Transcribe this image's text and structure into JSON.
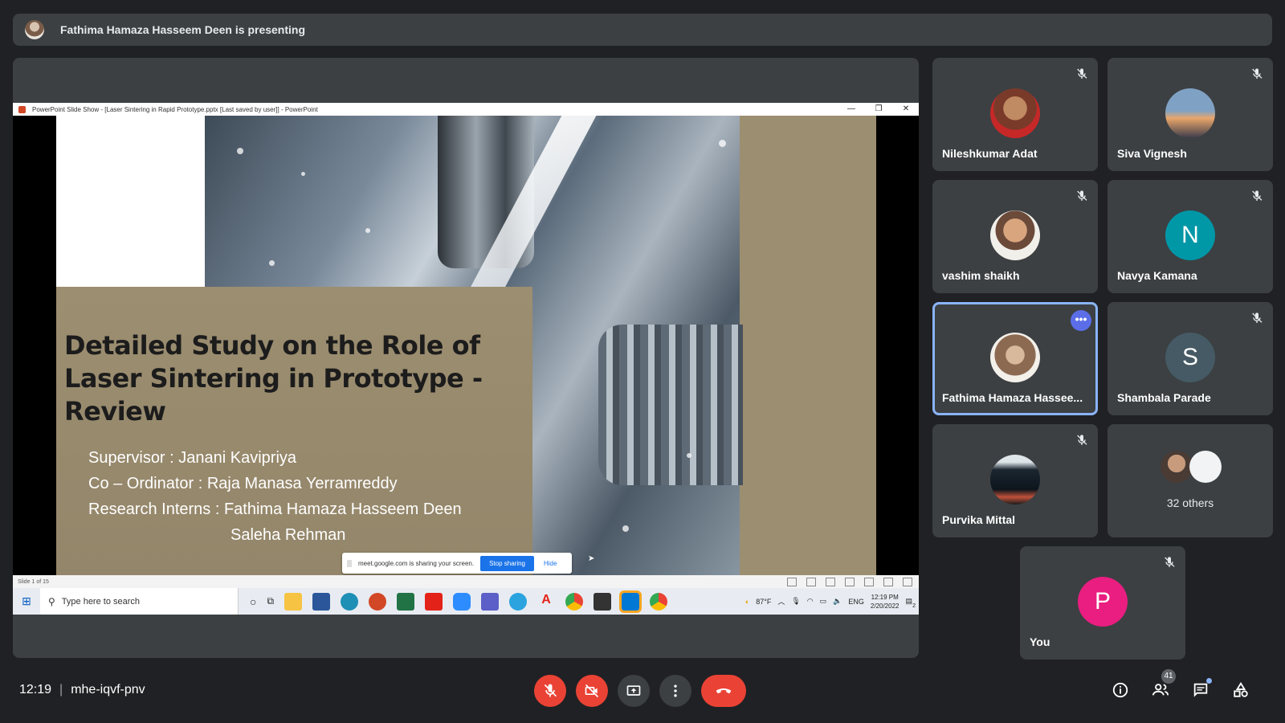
{
  "presenting_banner": {
    "text": "Fathima Hamaza Hasseem Deen is presenting"
  },
  "shared_screen": {
    "window_title": "PowerPoint Slide Show - [Laser Sintering in Rapid Prototype.pptx [Last saved by user]] - PowerPoint",
    "slide": {
      "title": "Detailed Study on the Role of Laser Sintering in Prototype - Review",
      "supervisor": "Supervisor :  Janani Kavipriya",
      "coordinator": "Co – Ordinator : Raja Manasa Yerramreddy",
      "interns_line1": "Research  Interns : Fathima Hamaza Hasseem Deen",
      "interns_line2": "Saleha Rehman"
    },
    "status_slide_count": "Slide 1 of 15",
    "share_notice": {
      "text": "meet.google.com is sharing your screen.",
      "stop_label": "Stop sharing",
      "hide_label": "Hide"
    },
    "taskbar": {
      "search_placeholder": "Type here to search",
      "weather": "87°F",
      "language": "ENG",
      "time": "12:19 PM",
      "date": "2/20/2022",
      "notification_count": "2"
    }
  },
  "participants": [
    {
      "name": "Nileshkumar Adat",
      "muted": true,
      "avatar": "photo"
    },
    {
      "name": "Siva Vignesh",
      "muted": true,
      "avatar": "photo"
    },
    {
      "name": "vashim shaikh",
      "muted": true,
      "avatar": "photo"
    },
    {
      "name": "Navya Kamana",
      "muted": true,
      "avatar": "letter",
      "letter": "N",
      "color": "#0097a7"
    },
    {
      "name": "Fathima Hamaza Hassee...",
      "muted": false,
      "avatar": "photo",
      "active": true
    },
    {
      "name": "Shambala Parade",
      "muted": true,
      "avatar": "letter",
      "letter": "S",
      "color": "#455a64"
    },
    {
      "name": "Purvika Mittal",
      "muted": true,
      "avatar": "photo"
    },
    {
      "name": "You",
      "muted": true,
      "avatar": "letter",
      "letter": "P",
      "color": "#e91e80"
    }
  ],
  "others_tile": {
    "label": "32 others"
  },
  "bottom_bar": {
    "time": "12:19",
    "meeting_code": "mhe-iqvf-pnv",
    "people_count": "41"
  },
  "colors": {
    "background": "#202124",
    "tile": "#3c4043",
    "danger": "#ea4335",
    "accent": "#8ab4f8"
  }
}
